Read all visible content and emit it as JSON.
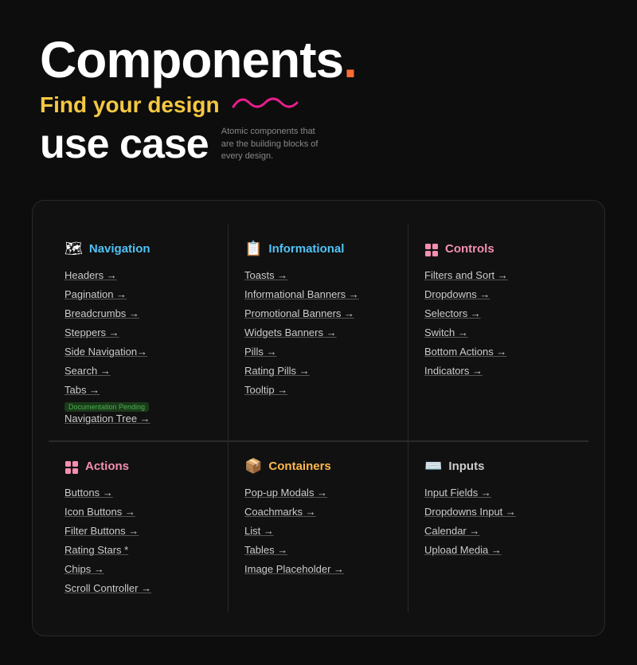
{
  "hero": {
    "title": "Components",
    "dot": ".",
    "find_text": "Find your design",
    "usecase_text": "use case",
    "desc_text": "Atomic components that are the building blocks of every design."
  },
  "sections": {
    "navigation": {
      "icon": "🗺",
      "title": "Navigation",
      "color_class": "navigation",
      "links": [
        {
          "label": "Headers →",
          "badge": null
        },
        {
          "label": "Pagination →",
          "badge": null
        },
        {
          "label": "Breadcrumbs →",
          "badge": null
        },
        {
          "label": "Steppers →",
          "badge": null
        },
        {
          "label": "Side Navigation→",
          "badge": null
        },
        {
          "label": "Search →",
          "badge": null
        },
        {
          "label": "Tabs →",
          "badge": null
        },
        {
          "label": "Navigation Tree →",
          "badge": "Documentation Pending"
        }
      ]
    },
    "informational": {
      "icon": "📋",
      "title": "Informational",
      "color_class": "informational",
      "links": [
        {
          "label": "Toasts →",
          "badge": null
        },
        {
          "label": "Informational Banners →",
          "badge": null
        },
        {
          "label": "Promotional Banners →",
          "badge": null
        },
        {
          "label": "Widgets Banners →",
          "badge": null
        },
        {
          "label": "Pills →",
          "badge": null
        },
        {
          "label": "Rating Pills →",
          "badge": null
        },
        {
          "label": "Tooltip →",
          "badge": null
        }
      ]
    },
    "controls": {
      "icon": "⊞",
      "title": "Controls",
      "color_class": "controls",
      "links": [
        {
          "label": "Filters and Sort →",
          "badge": null
        },
        {
          "label": "Dropdowns →",
          "badge": null
        },
        {
          "label": "Selectors →",
          "badge": null
        },
        {
          "label": "Switch →",
          "badge": null
        },
        {
          "label": "Bottom Actions →",
          "badge": null
        },
        {
          "label": "Indicators →",
          "badge": null
        }
      ]
    },
    "actions": {
      "icon": "⊞",
      "title": "Actions",
      "color_class": "actions",
      "links": [
        {
          "label": "Buttons →",
          "badge": null
        },
        {
          "label": "Icon Buttons →",
          "badge": null
        },
        {
          "label": "Filter Buttons →",
          "badge": null
        },
        {
          "label": "Rating Stars  *",
          "badge": null
        },
        {
          "label": "Chips →",
          "badge": null
        },
        {
          "label": "Scroll Controller →",
          "badge": null
        }
      ]
    },
    "containers": {
      "icon": "📦",
      "title": "Containers",
      "color_class": "containers",
      "links": [
        {
          "label": "Pop-up Modals →",
          "badge": null
        },
        {
          "label": "Coachmarks →",
          "badge": null
        },
        {
          "label": "List →",
          "badge": null
        },
        {
          "label": "Tables →",
          "badge": null
        },
        {
          "label": "Image Placeholder →",
          "badge": null
        }
      ]
    },
    "inputs": {
      "icon": "⌨",
      "title": "Inputs",
      "color_class": "inputs",
      "links": [
        {
          "label": "Input Fields →",
          "badge": null
        },
        {
          "label": "Dropdowns Input →",
          "badge": null
        },
        {
          "label": "Calendar →",
          "badge": null
        },
        {
          "label": "Upload Media →",
          "badge": null
        }
      ]
    }
  }
}
